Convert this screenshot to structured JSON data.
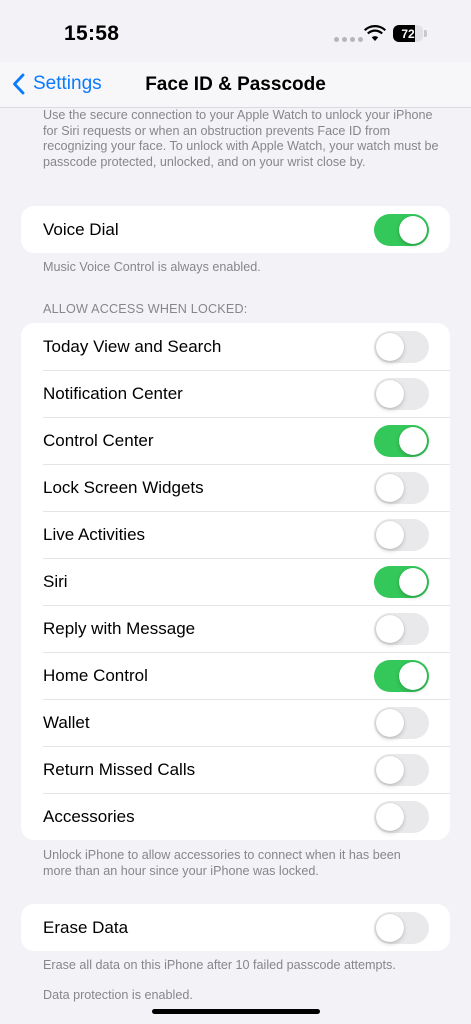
{
  "status_bar": {
    "time": "15:58",
    "battery_level": "72",
    "battery_fraction": 0.72,
    "icons": [
      "signal-dots",
      "wifi-icon",
      "battery-icon"
    ]
  },
  "nav": {
    "back_label": "Settings",
    "title": "Face ID & Passcode"
  },
  "top_footnote": "Use the secure connection to your Apple Watch to unlock your iPhone for Siri requests or when an obstruction prevents Face ID from recognizing your face. To unlock with Apple Watch, your watch must be passcode protected, unlocked, and on your wrist close by.",
  "voice_dial": {
    "label": "Voice Dial",
    "on": true,
    "footnote": "Music Voice Control is always enabled."
  },
  "locked_access": {
    "header": "ALLOW ACCESS WHEN LOCKED:",
    "items": [
      {
        "label": "Today View and Search",
        "on": false
      },
      {
        "label": "Notification Center",
        "on": false
      },
      {
        "label": "Control Center",
        "on": true
      },
      {
        "label": "Lock Screen Widgets",
        "on": false
      },
      {
        "label": "Live Activities",
        "on": false
      },
      {
        "label": "Siri",
        "on": true
      },
      {
        "label": "Reply with Message",
        "on": false
      },
      {
        "label": "Home Control",
        "on": true
      },
      {
        "label": "Wallet",
        "on": false
      },
      {
        "label": "Return Missed Calls",
        "on": false
      },
      {
        "label": "Accessories",
        "on": false
      }
    ],
    "footnote": "Unlock iPhone to allow accessories to connect when it has been more than an hour since your iPhone was locked."
  },
  "erase_data": {
    "label": "Erase Data",
    "on": false,
    "footnote": "Erase all data on this iPhone after 10 failed passcode attempts.",
    "footnote2": "Data protection is enabled."
  },
  "colors": {
    "accent": "#0a7aff",
    "toggle_on": "#34c759",
    "toggle_off": "#e9e9eb",
    "background": "#f2f2f7"
  }
}
